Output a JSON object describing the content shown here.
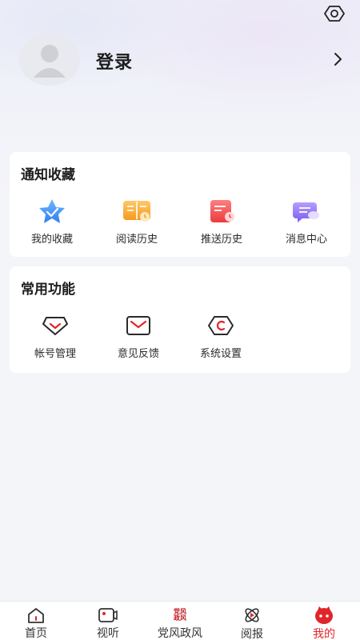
{
  "profile": {
    "login_label": "登录"
  },
  "sections": [
    {
      "title": "通知收藏",
      "items": [
        {
          "label": "我的收藏",
          "icon": "star-icon"
        },
        {
          "label": "阅读历史",
          "icon": "book-icon"
        },
        {
          "label": "推送历史",
          "icon": "calendar-icon"
        },
        {
          "label": "消息中心",
          "icon": "chat-icon"
        }
      ]
    },
    {
      "title": "常用功能",
      "items": [
        {
          "label": "帐号管理",
          "icon": "account-icon"
        },
        {
          "label": "意见反馈",
          "icon": "mail-icon"
        },
        {
          "label": "系统设置",
          "icon": "settings-icon"
        }
      ]
    }
  ],
  "tabbar": {
    "items": [
      {
        "label": "首页",
        "icon": "home-icon"
      },
      {
        "label": "视听",
        "icon": "video-icon"
      },
      {
        "label": "党风政风",
        "icon": "party-logo-icon",
        "icon_text": "党风政风"
      },
      {
        "label": "阅报",
        "icon": "atom-icon"
      },
      {
        "label": "我的",
        "icon": "profile-icon",
        "active": true
      }
    ]
  },
  "colors": {
    "accent": "#e0262b",
    "background": "#f4f5f9",
    "card": "#ffffff"
  }
}
